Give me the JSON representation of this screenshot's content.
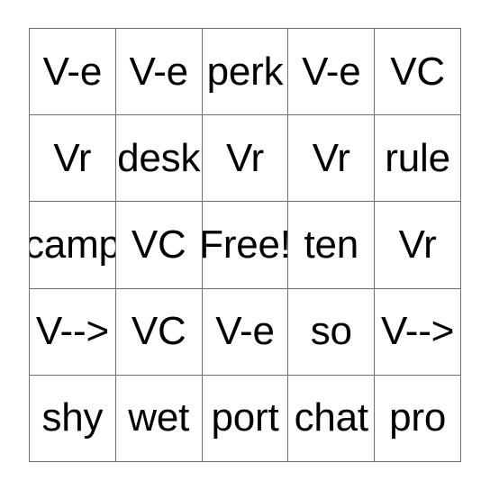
{
  "card": {
    "type": "bingo-card",
    "rows": 5,
    "columns": 5,
    "free_space_label": "Free!",
    "free_space_position": {
      "row": 3,
      "column": 3
    },
    "text_color": "#000000",
    "grid_line_color": "#707070",
    "background_color": "#ffffff",
    "cells": [
      [
        {
          "label": "V-e"
        },
        {
          "label": "V-e"
        },
        {
          "label": "perk"
        },
        {
          "label": "V-e"
        },
        {
          "label": "VC"
        }
      ],
      [
        {
          "label": "Vr"
        },
        {
          "label": "desk"
        },
        {
          "label": "Vr"
        },
        {
          "label": "Vr"
        },
        {
          "label": "rule"
        }
      ],
      [
        {
          "label": "camp"
        },
        {
          "label": "VC"
        },
        {
          "label": "Free!"
        },
        {
          "label": "ten"
        },
        {
          "label": "Vr"
        }
      ],
      [
        {
          "label": "V-->"
        },
        {
          "label": "VC"
        },
        {
          "label": "V-e"
        },
        {
          "label": "so"
        },
        {
          "label": "V-->"
        }
      ],
      [
        {
          "label": "shy"
        },
        {
          "label": "wet"
        },
        {
          "label": "port"
        },
        {
          "label": "chat"
        },
        {
          "label": "pro"
        }
      ]
    ]
  }
}
